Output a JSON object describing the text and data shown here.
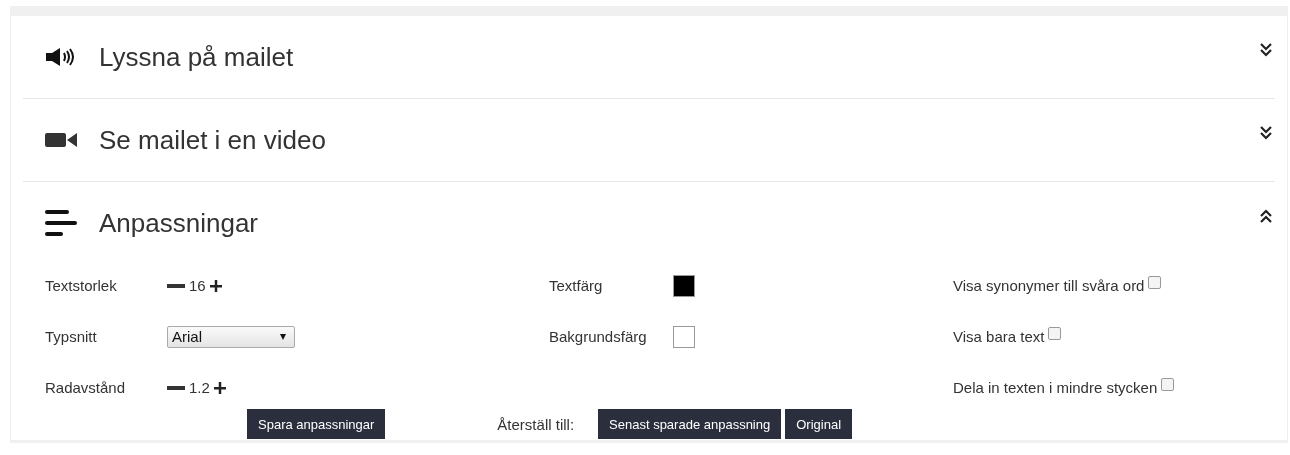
{
  "sections": [
    {
      "title": "Lyssna på mailet",
      "kind": "audio",
      "expanded": false
    },
    {
      "title": "Se mailet i en video",
      "kind": "video",
      "expanded": false
    },
    {
      "title": "Anpassningar",
      "kind": "settings",
      "expanded": true
    }
  ],
  "settings": {
    "left": [
      {
        "label": "Textstorlek",
        "kind": "stepper",
        "value": "16"
      },
      {
        "label": "Typsnitt",
        "kind": "select",
        "value": "Arial"
      },
      {
        "label": "Radavstånd",
        "kind": "stepper",
        "value": "1.2"
      }
    ],
    "middle": [
      {
        "label": "Textfärg",
        "color": "#000000"
      },
      {
        "label": "Bakgrundsfärg",
        "color": "#ffffff"
      }
    ],
    "right": [
      {
        "label": "Visa synonymer till svåra ord",
        "checked": false
      },
      {
        "label": "Visa bara text",
        "checked": false
      },
      {
        "label": "Dela in texten i mindre stycken",
        "checked": false
      }
    ]
  },
  "save_button": "Spara anpassningar",
  "reset_label": "Återställ till:",
  "reset_buttons": [
    "Senast sparade anpassning",
    "Original"
  ]
}
